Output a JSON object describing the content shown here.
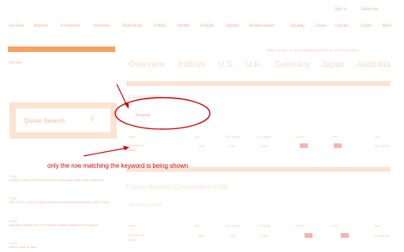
{
  "topbar": {
    "sign_in": "Sign In",
    "subscribe": "Subscribe",
    "more": "More"
  },
  "nav": [
    "Live Now",
    "Markets",
    "Economics",
    "Industries",
    "Technology",
    "Politics",
    "Wealth",
    "Pursuits",
    "Opinion",
    "Businessweek",
    "Equality",
    "Green",
    "CityLab",
    "Crypto",
    "More"
  ],
  "breadcrumb": "Before it's here, it's on the Bloomberg Terminal.   LIVE  Connections",
  "sidebar": {
    "markets_label": "Markets",
    "quote_search_label": "Quote Search",
    "news": [
      {
        "tag": "1h ago",
        "head": "Turkey Looks to Personal Bond to Encourage Base-Wide Dollar Use"
      },
      {
        "tag": "2h ago",
        "head": "IMF, G20 & Credit Groups Announced New Deal in Moody's Debt Check"
      },
      {
        "tag": "3h ago",
        "head": "Argentina Wealth Fund Is Seeking Global Infrastructure Projects"
      },
      {
        "tag": "4h ago",
        "head": "Stocks Slide in Asia"
      }
    ]
  },
  "tabs": [
    "Overview",
    "Indices",
    "U.S.",
    "U.K.",
    "Germany",
    "Japan",
    "Australia"
  ],
  "main": {
    "section_title": "Currency Matrix",
    "filter_keyword": "Rmends",
    "table_headers": [
      "Name",
      "Last",
      "Net Change",
      "% Change",
      "1 Month",
      "1 Year",
      "Time"
    ],
    "row": {
      "name_line1": "Rmends Ltd",
      "name_line2": "RMND",
      "values": [
        "4.85",
        "0.05",
        "1.04%",
        "",
        "",
        ""
      ],
      "time": "3:41 PM EDT"
    },
    "section2_title": "Futures Markets Commodities (US$)",
    "updated_text": "Data as of: Jul 10, 2023",
    "table2_headers": [
      "Name",
      "Last",
      "Net Change",
      "% Change",
      "1 Month",
      "1 Year",
      "Time"
    ],
    "row2": {
      "name_line1": "Rmends Ltd",
      "name_line2": "RMND",
      "values": [
        "4.85",
        "0.05",
        "1.04%"
      ],
      "time": "3:41 PM EDT"
    }
  },
  "annotation": "only the row matching the keyword is being shown",
  "colors": {
    "accent": "#f7a262",
    "annotation": "#d40000",
    "highlight": "#f6b4b1"
  }
}
